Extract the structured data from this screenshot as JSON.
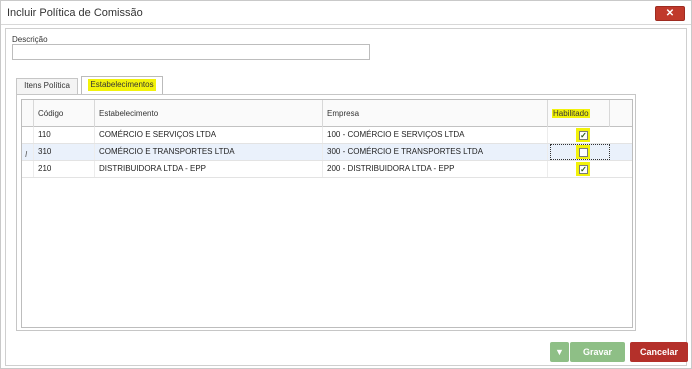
{
  "window": {
    "title": "Incluir Política de Comissão",
    "close_label": "✕"
  },
  "form": {
    "descricao_label": "Descrição",
    "descricao_value": "",
    "descricao_placeholder": ""
  },
  "tabs": [
    {
      "label": "Itens Política",
      "active": false
    },
    {
      "label": "Estabelecimentos",
      "active": true,
      "highlighted": true
    }
  ],
  "grid": {
    "columns": [
      "Código",
      "Estabelecimento",
      "Empresa",
      "Habilitado"
    ],
    "rows": [
      {
        "codigo": "110",
        "estabelecimento": "COMÉRCIO E SERVIÇOS LTDA",
        "empresa": "100 - COMÉRCIO E SERVIÇOS LTDA",
        "habilitado": true,
        "selected": false
      },
      {
        "codigo": "310",
        "estabelecimento": "COMÉRCIO E TRANSPORTES LTDA",
        "empresa": "300 - COMÉRCIO E TRANSPORTES LTDA",
        "habilitado": false,
        "selected": true,
        "indicator": "I"
      },
      {
        "codigo": "210",
        "estabelecimento": "DISTRIBUIDORA LTDA - EPP",
        "empresa": "200 - DISTRIBUIDORA LTDA - EPP",
        "habilitado": true,
        "selected": false
      }
    ]
  },
  "buttons": {
    "dropdown_icon": "▼",
    "gravar": "Gravar",
    "cancelar": "Cancelar"
  },
  "colors": {
    "highlight": "#f2f20a",
    "gravar": "#8ebf86",
    "cancelar": "#b4302a",
    "close": "#c0392b"
  }
}
